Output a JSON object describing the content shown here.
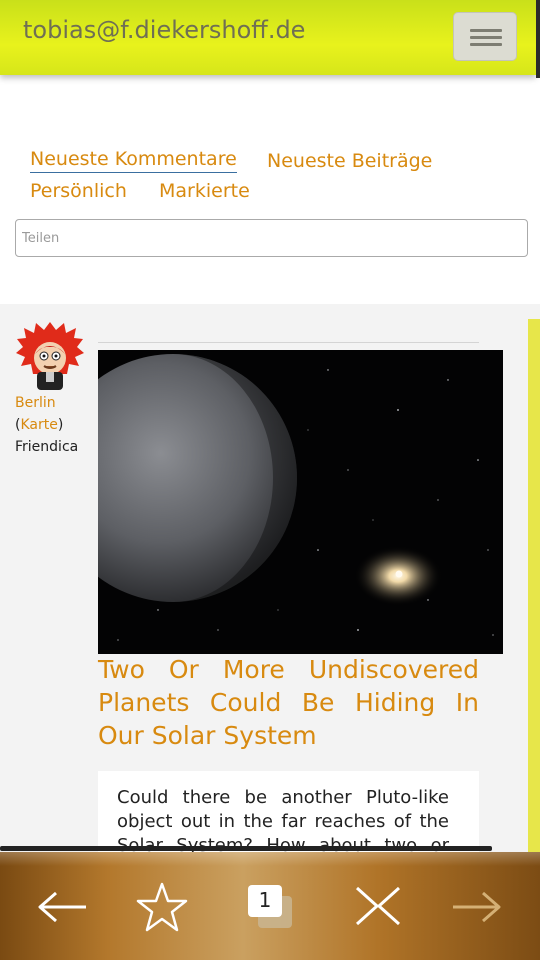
{
  "header": {
    "title": "tobias@f.diekershoff.de",
    "menu_icon": "hamburger-menu-icon"
  },
  "tabs": [
    {
      "label": "Neueste Kommentare",
      "active": true
    },
    {
      "label": "Neueste Beiträge",
      "active": false
    },
    {
      "label": "Persönlich",
      "active": false
    },
    {
      "label": "Markierte",
      "active": false
    }
  ],
  "share": {
    "placeholder": "Teilen",
    "value": ""
  },
  "post": {
    "author_location": "Berlin",
    "map_paren_open": "(",
    "map_link": "Karte",
    "map_paren_close": ")",
    "network": "Friendica",
    "title": "Two Or More Undiscovered Planets Could Be Hiding In Our Solar System",
    "body": "Could there be another Pluto-like object out in the far reaches of the Solar System? How about two or more?"
  },
  "browser_toolbar": {
    "tab_count": "1",
    "icons": [
      "back-arrow-icon",
      "bookmark-star-icon",
      "tabs-icon",
      "close-x-icon",
      "forward-arrow-icon"
    ]
  },
  "colors": {
    "header": "#e3ef1c",
    "link": "#d88a10",
    "scroll_stripe": "#e7e64a"
  }
}
